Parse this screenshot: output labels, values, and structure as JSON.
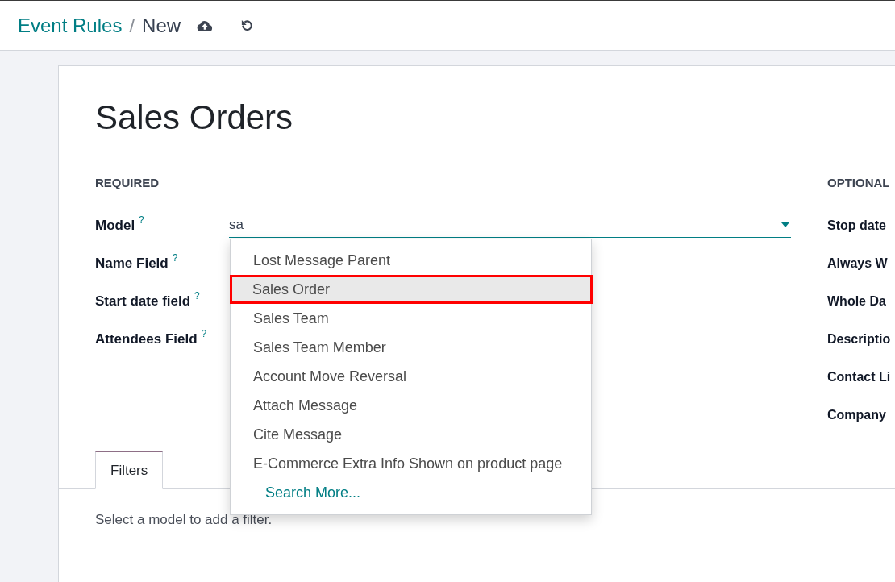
{
  "breadcrumb": {
    "parent": "Event Rules",
    "separator": "/",
    "current": "New"
  },
  "toolbar": [
    {
      "kind": "save"
    },
    {
      "kind": "discard"
    }
  ],
  "title": "Sales Orders",
  "required": {
    "heading": "REQUIRED",
    "fields": [
      {
        "label": "Model",
        "help": "?",
        "value": "sa",
        "dropdown": {
          "items": [
            {
              "label": "Lost Message Parent",
              "selected": false,
              "highlighted": false
            },
            {
              "label": "Sales Order",
              "selected": true,
              "highlighted": true
            },
            {
              "label": "Sales Team",
              "selected": false,
              "highlighted": false
            },
            {
              "label": "Sales Team Member",
              "selected": false,
              "highlighted": false
            },
            {
              "label": "Account Move Reversal",
              "selected": false,
              "highlighted": false
            },
            {
              "label": "Attach Message",
              "selected": false,
              "highlighted": false
            },
            {
              "label": "Cite Message",
              "selected": false,
              "highlighted": false
            },
            {
              "label": "E-Commerce Extra Info Shown on product page",
              "selected": false,
              "highlighted": false
            }
          ],
          "search_more": "Search More..."
        }
      },
      {
        "label": "Name Field",
        "help": "?"
      },
      {
        "label": "Start date field",
        "help": "?"
      },
      {
        "label": "Attendees Field",
        "help": "?"
      }
    ]
  },
  "optional": {
    "heading": "OPTIONAL",
    "fields": [
      {
        "label": "Stop date"
      },
      {
        "label": "Always W"
      },
      {
        "label": "Whole Da"
      },
      {
        "label": "Descriptio"
      },
      {
        "label": "Contact Li"
      },
      {
        "label": "Company"
      }
    ]
  },
  "tabs": [
    {
      "label": "Filters",
      "selected": true
    }
  ],
  "filters_hint": "Select a model to add a filter."
}
